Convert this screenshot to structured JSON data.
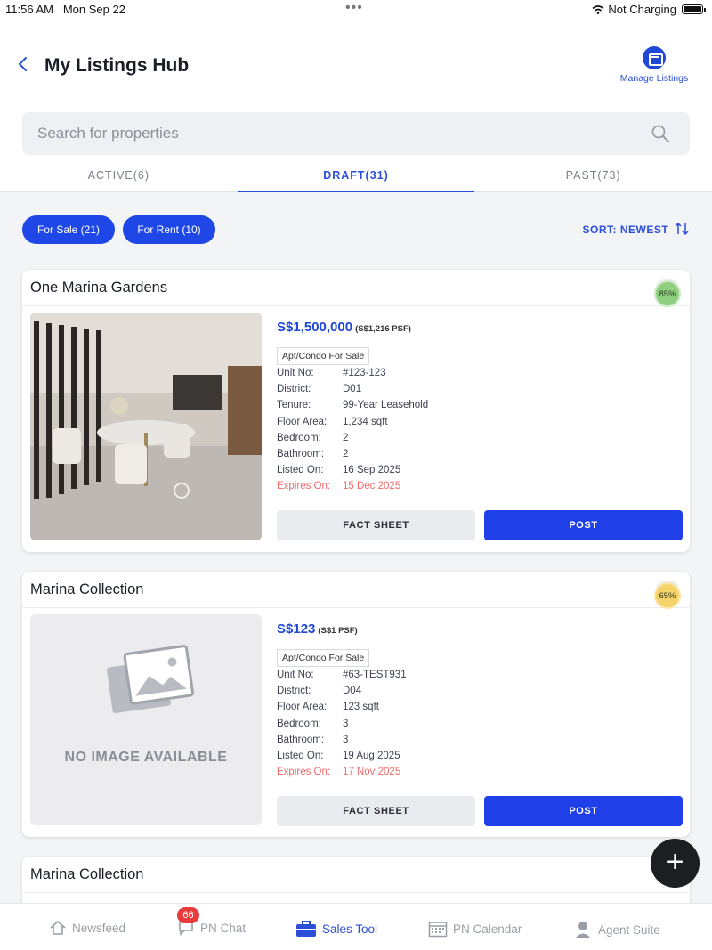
{
  "status_bar": {
    "time": "11:56 AM",
    "date": "Mon Sep 22",
    "charging": "Not Charging"
  },
  "header": {
    "back_icon": "chevron-left-icon",
    "title": "My Listings Hub",
    "manage_label": "Manage Listings",
    "manage_icon": "folder-icon"
  },
  "search": {
    "placeholder": "Search for properties",
    "icon": "search-icon"
  },
  "tabs": [
    {
      "label": "ACTIVE(6)",
      "active": false
    },
    {
      "label": "DRAFT(31)",
      "active": true
    },
    {
      "label": "PAST(73)",
      "active": false
    }
  ],
  "filters": {
    "for_sale": "For Sale (21)",
    "for_rent": "For Rent (10)",
    "sort": "SORT: NEWEST"
  },
  "listings": [
    {
      "title": "One Marina Gardens",
      "price": "S$1,500,000",
      "psf": "(S$1,216 PSF)",
      "score": "85%",
      "score_color": "#8fcf80",
      "type": "Apt/Condo For Sale",
      "details": [
        {
          "k": "Unit No:",
          "v": "#123-123"
        },
        {
          "k": "District:",
          "v": "D01"
        },
        {
          "k": "Tenure:",
          "v": "99-Year Leasehold"
        },
        {
          "k": "Floor Area:",
          "v": "1,234 sqft"
        },
        {
          "k": "Bedroom:",
          "v": "2"
        },
        {
          "k": "Bathroom:",
          "v": "2"
        },
        {
          "k": "Listed On:",
          "v": "16 Sep 2025"
        }
      ],
      "expires": {
        "k": "Expires On:",
        "v": "15 Dec 2025"
      },
      "fact_sheet": "FACT SHEET",
      "post": "POST"
    },
    {
      "title": "Marina Collection",
      "price": "S$123",
      "psf": "(S$1 PSF)",
      "score": "65%",
      "score_color": "#f6d36a",
      "type": "Apt/Condo For Sale",
      "no_image": "NO IMAGE AVAILABLE",
      "details": [
        {
          "k": "Unit No:",
          "v": "#63-TEST931"
        },
        {
          "k": "District:",
          "v": "D04"
        },
        {
          "k": "Floor Area:",
          "v": "123 sqft"
        },
        {
          "k": "Bedroom:",
          "v": "3"
        },
        {
          "k": "Bathroom:",
          "v": "3"
        },
        {
          "k": "Listed On:",
          "v": "19 Aug 2025"
        }
      ],
      "expires": {
        "k": "Expires On:",
        "v": "17 Nov 2025"
      },
      "fact_sheet": "FACT SHEET",
      "post": "POST"
    },
    {
      "title": "Marina Collection"
    }
  ],
  "fab": "+",
  "nav": [
    {
      "label": "Newsfeed",
      "icon": "home-icon"
    },
    {
      "label": "PN Chat",
      "icon": "chat-icon",
      "badge": "66"
    },
    {
      "label": "Sales Tool",
      "icon": "briefcase-icon",
      "active": true
    },
    {
      "label": "PN Calendar",
      "icon": "calendar-icon"
    },
    {
      "label": "Agent Suite",
      "icon": "person-icon"
    }
  ]
}
